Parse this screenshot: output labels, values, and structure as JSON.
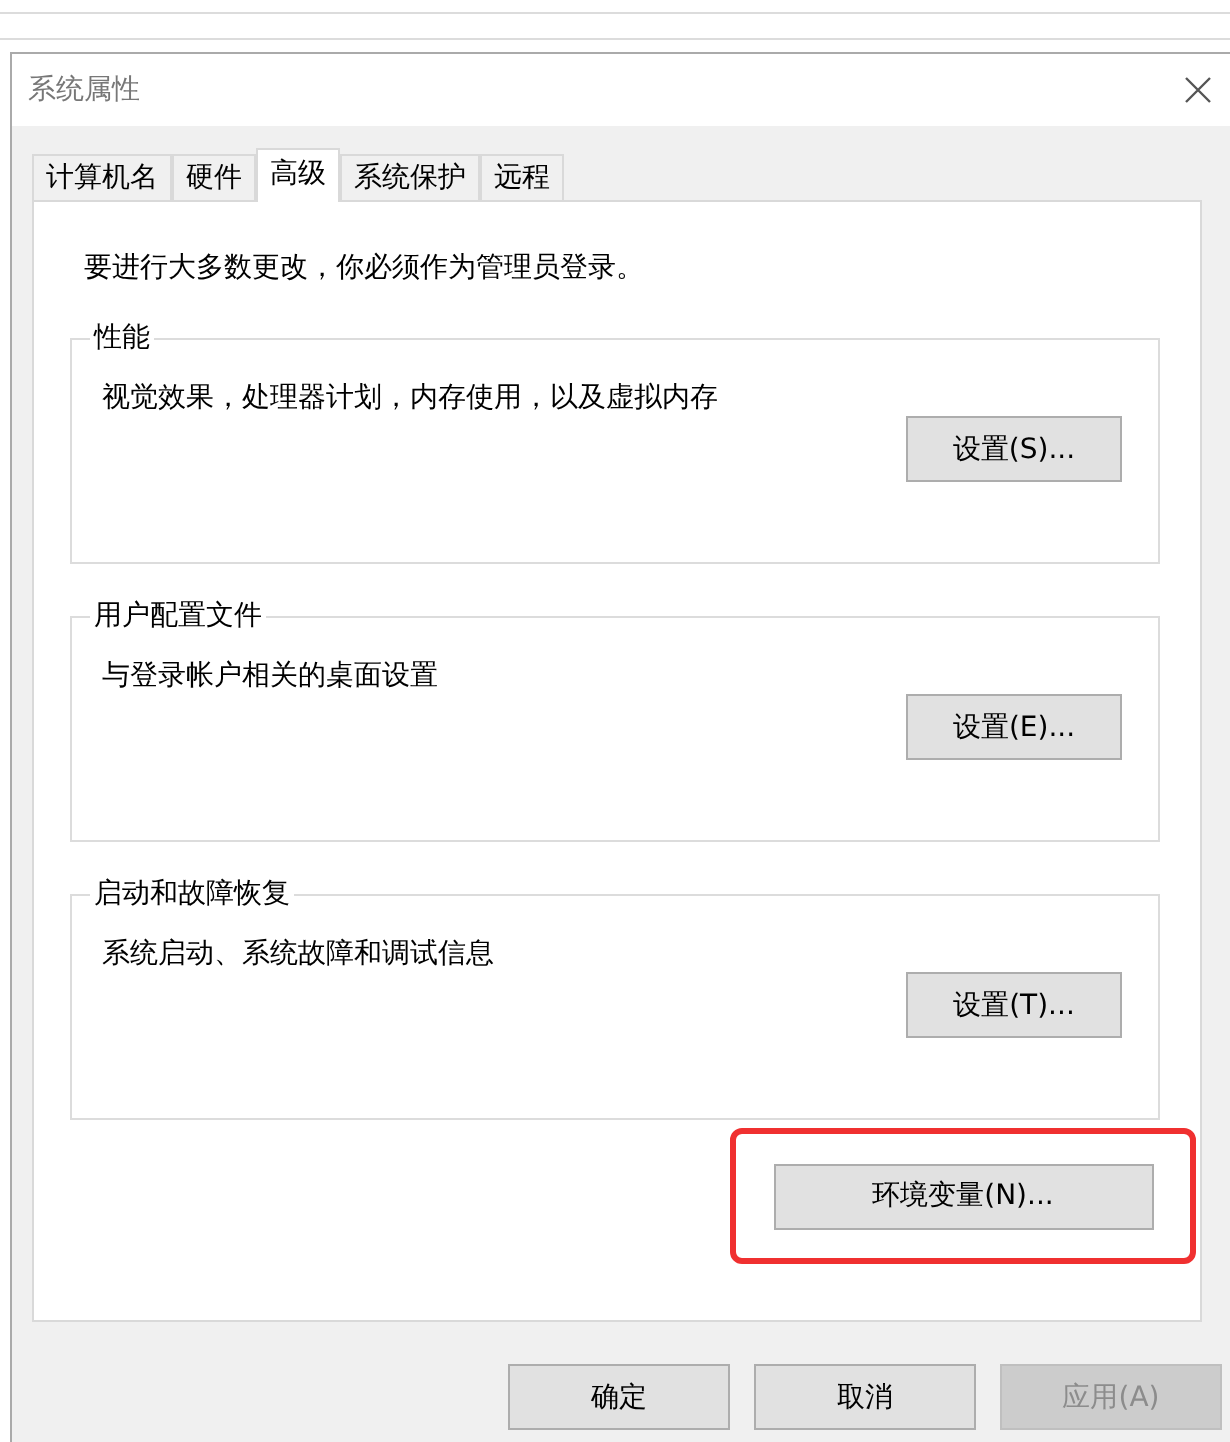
{
  "window": {
    "title": "系统属性"
  },
  "tabs": [
    {
      "label": "计算机名",
      "selected": false
    },
    {
      "label": "硬件",
      "selected": false
    },
    {
      "label": "高级",
      "selected": true
    },
    {
      "label": "系统保护",
      "selected": false
    },
    {
      "label": "远程",
      "selected": false
    }
  ],
  "notice": "要进行大多数更改，你必须作为管理员登录。",
  "groups": [
    {
      "title": "性能",
      "description": "视觉效果，处理器计划，内存使用，以及虚拟内存",
      "button": "设置(S)..."
    },
    {
      "title": "用户配置文件",
      "description": "与登录帐户相关的桌面设置",
      "button": "设置(E)..."
    },
    {
      "title": "启动和故障恢复",
      "description": "系统启动、系统故障和调试信息",
      "button": "设置(T)..."
    }
  ],
  "environment_button": {
    "label": "环境变量(N)...",
    "highlighted": true
  },
  "buttons": [
    {
      "label": "确定",
      "disabled": false
    },
    {
      "label": "取消",
      "disabled": false
    },
    {
      "label": "应用(A)",
      "disabled": true
    }
  ]
}
